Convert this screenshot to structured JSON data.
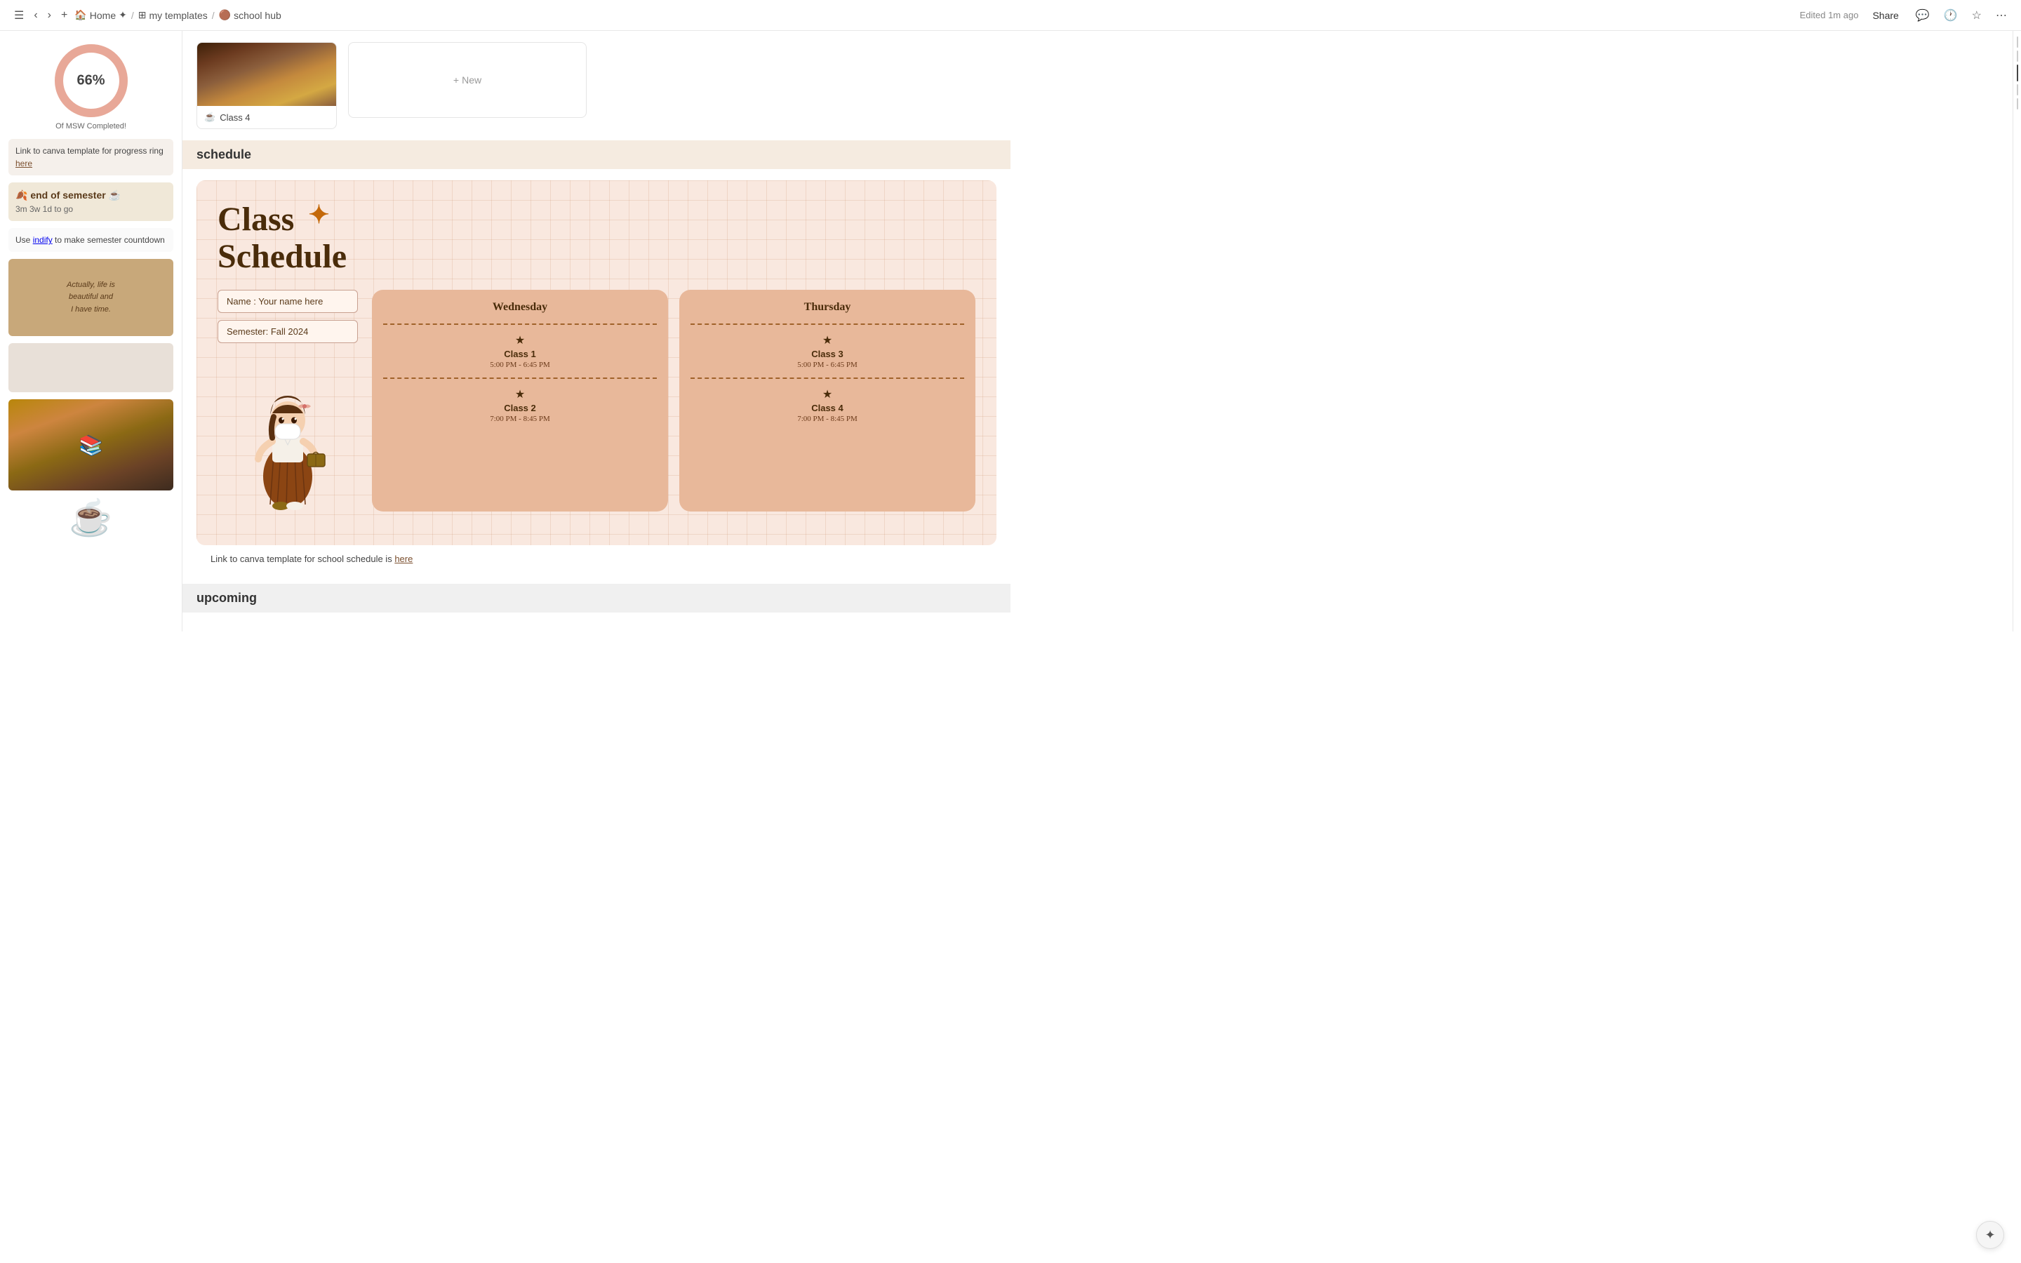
{
  "nav": {
    "back_btn": "‹",
    "forward_btn": "›",
    "new_tab_btn": "+",
    "home_icon": "🏠",
    "home_label": "Home",
    "breadcrumb_sep1": "/",
    "templates_icon": "⊞",
    "templates_label": "my templates",
    "breadcrumb_sep2": "/",
    "page_icon": "🟤",
    "page_label": "school hub",
    "edited_text": "Edited 1m ago",
    "share_label": "Share",
    "comment_icon": "💬",
    "history_icon": "🕐",
    "favorite_icon": "☆",
    "more_icon": "⋯"
  },
  "sidebar": {
    "progress_percent": "66%",
    "progress_subtitle": "Of MSW Completed!",
    "canva_link_text": "Link to canva template for progress ring ",
    "canva_link_anchor": "here",
    "end_of_semester_emoji": "🍂",
    "end_of_semester_label": "end of semester ☕",
    "countdown_text": "3m 3w 1d to go",
    "indify_text": "Use ",
    "indify_link": "indify",
    "indify_text2": " to make semester countdown",
    "quote_line1": "Actually, life is",
    "quote_line2": "beautiful and",
    "quote_line3": "I have time.",
    "teacup_emoji": "☕"
  },
  "class_cards": [
    {
      "label": "Class 4",
      "icon": "☕"
    }
  ],
  "new_card": {
    "plus": "+",
    "label": "New"
  },
  "schedule_section": {
    "header": "schedule",
    "title_line1": "Class",
    "title_line2": "Schedule",
    "star": "✦",
    "name_placeholder": "Name  :  Your name here",
    "semester_placeholder": "Semester: Fall 2024",
    "days": [
      {
        "name": "Wednesday",
        "classes": [
          {
            "name": "Class 1",
            "time": "5:00 PM - 6:45 PM"
          },
          {
            "name": "Class 2",
            "time": "7:00 PM - 8:45 PM"
          }
        ]
      },
      {
        "name": "Thursday",
        "classes": [
          {
            "name": "Class 3",
            "time": "5:00 PM - 6:45 PM"
          },
          {
            "name": "Class 4",
            "time": "7:00 PM - 8:45 PM"
          }
        ]
      }
    ],
    "canva_link_prefix": "Link to canva template for school schedule is ",
    "canva_link_anchor": "here"
  },
  "upcoming_section": {
    "header": "upcoming"
  },
  "colors": {
    "schedule_bg": "#f9e8df",
    "day_card_bg": "#e8b89a",
    "accent_brown": "#4a2c0a",
    "star_orange": "#c4690a"
  }
}
